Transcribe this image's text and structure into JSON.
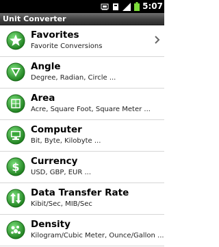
{
  "status_bar": {
    "time": "5:07",
    "icons": [
      "usb-debug-icon",
      "notification-icon",
      "signal-icon",
      "battery-icon"
    ]
  },
  "app": {
    "title": "Unit Converter",
    "accent": "#2e9d2e"
  },
  "list": {
    "items": [
      {
        "title": "Favorites",
        "subtitle": "Favorite Conversions",
        "icon": "star-icon",
        "has_chevron": true
      },
      {
        "title": "Angle",
        "subtitle": "Degree, Radian, Circle ...",
        "icon": "angle-icon"
      },
      {
        "title": "Area",
        "subtitle": "Acre, Square Foot, Square Meter ...",
        "icon": "area-icon"
      },
      {
        "title": "Computer",
        "subtitle": "Bit, Byte, Kilobyte ...",
        "icon": "computer-icon"
      },
      {
        "title": "Currency",
        "subtitle": "USD, GBP, EUR ...",
        "icon": "currency-icon"
      },
      {
        "title": "Data Transfer Rate",
        "subtitle": "Kibit/Sec, MIB/Sec",
        "icon": "transfer-icon"
      },
      {
        "title": "Density",
        "subtitle": "Kilogram/Cubic Meter, Ounce/Gallon ...",
        "icon": "density-icon"
      }
    ]
  }
}
